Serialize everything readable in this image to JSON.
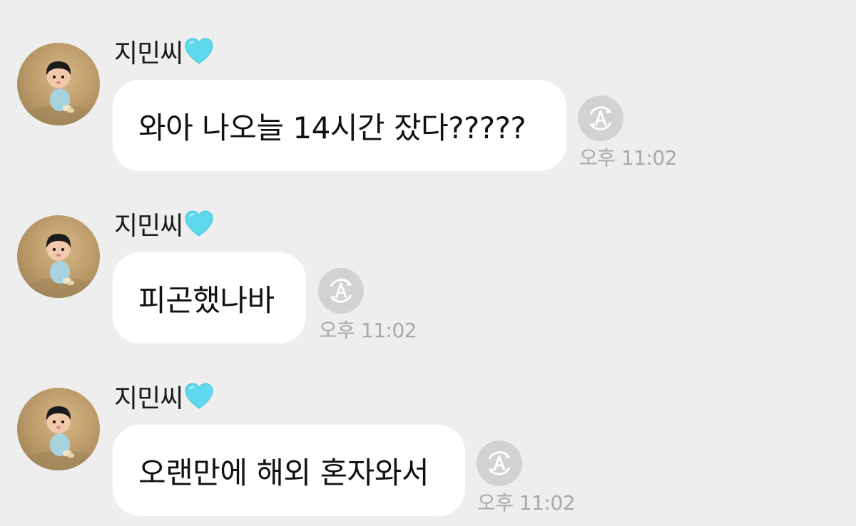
{
  "chat": {
    "messages": [
      {
        "sender": "지민씨",
        "text": "와아 나오늘 14시간 잤다?????",
        "time": "오후 11:02",
        "avatar_icon": "profile-avatar-icon",
        "heart_icon": "light-blue-heart-icon",
        "translate_icon": "translate-icon"
      },
      {
        "sender": "지민씨",
        "text": "피곤했나바",
        "time": "오후 11:02",
        "avatar_icon": "profile-avatar-icon",
        "heart_icon": "light-blue-heart-icon",
        "translate_icon": "translate-icon"
      },
      {
        "sender": "지민씨",
        "text": "오랜만에 해외 혼자와서",
        "time": "오후 11:02",
        "avatar_icon": "profile-avatar-icon",
        "heart_icon": "light-blue-heart-icon",
        "translate_icon": "translate-icon"
      }
    ]
  },
  "colors": {
    "background": "#eeeeee",
    "bubble": "#ffffff",
    "heart": "#5fd8ee",
    "icon_gray": "#d2d2d2",
    "time_text": "#a8a8a8"
  }
}
